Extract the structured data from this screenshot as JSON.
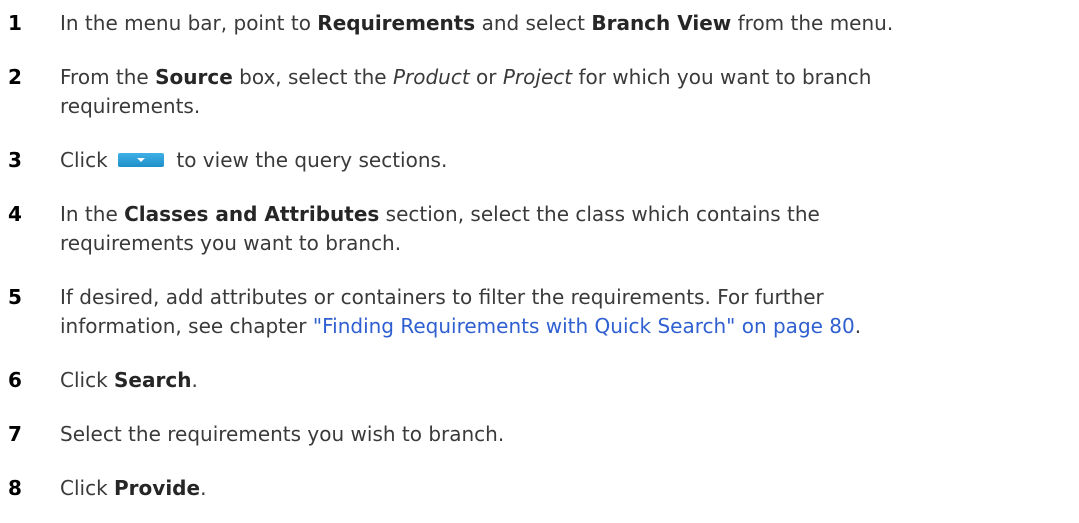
{
  "steps": [
    {
      "number": "1",
      "t1": "In the menu bar, point to ",
      "b1": "Requirements",
      "t2": " and select ",
      "b2": "Branch View",
      "t3": " from the menu."
    },
    {
      "number": "2",
      "t1": "From the ",
      "b1": "Source",
      "t2": " box, select the ",
      "i1": "Product",
      "t3": " or ",
      "i2": "Project",
      "t4": " for which you want to branch",
      "line2": "requirements."
    },
    {
      "number": "3",
      "t1": "Click ",
      "t2": " to view the query sections.",
      "icon": "expand-query-icon"
    },
    {
      "number": "4",
      "t1": "In the ",
      "b1": "Classes and Attributes",
      "t2": " section, select the class which contains the",
      "line2": "requirements you want to branch."
    },
    {
      "number": "5",
      "t1": "If desired, add attributes or containers to filter the requirements. For further",
      "line2_text": "information, see chapter ",
      "link": "\"Finding Requirements with Quick Search\" on page 80",
      "line2_end": "."
    },
    {
      "number": "6",
      "t1": "Click ",
      "b1": "Search",
      "t2": "."
    },
    {
      "number": "7",
      "t1": "Select the requirements you wish to branch."
    },
    {
      "number": "8",
      "t1": "Click ",
      "b1": "Provide",
      "t2": "."
    }
  ],
  "colors": {
    "text": "#3a3a3a",
    "link": "#2f5fd0",
    "button": "#1f8fc9"
  }
}
